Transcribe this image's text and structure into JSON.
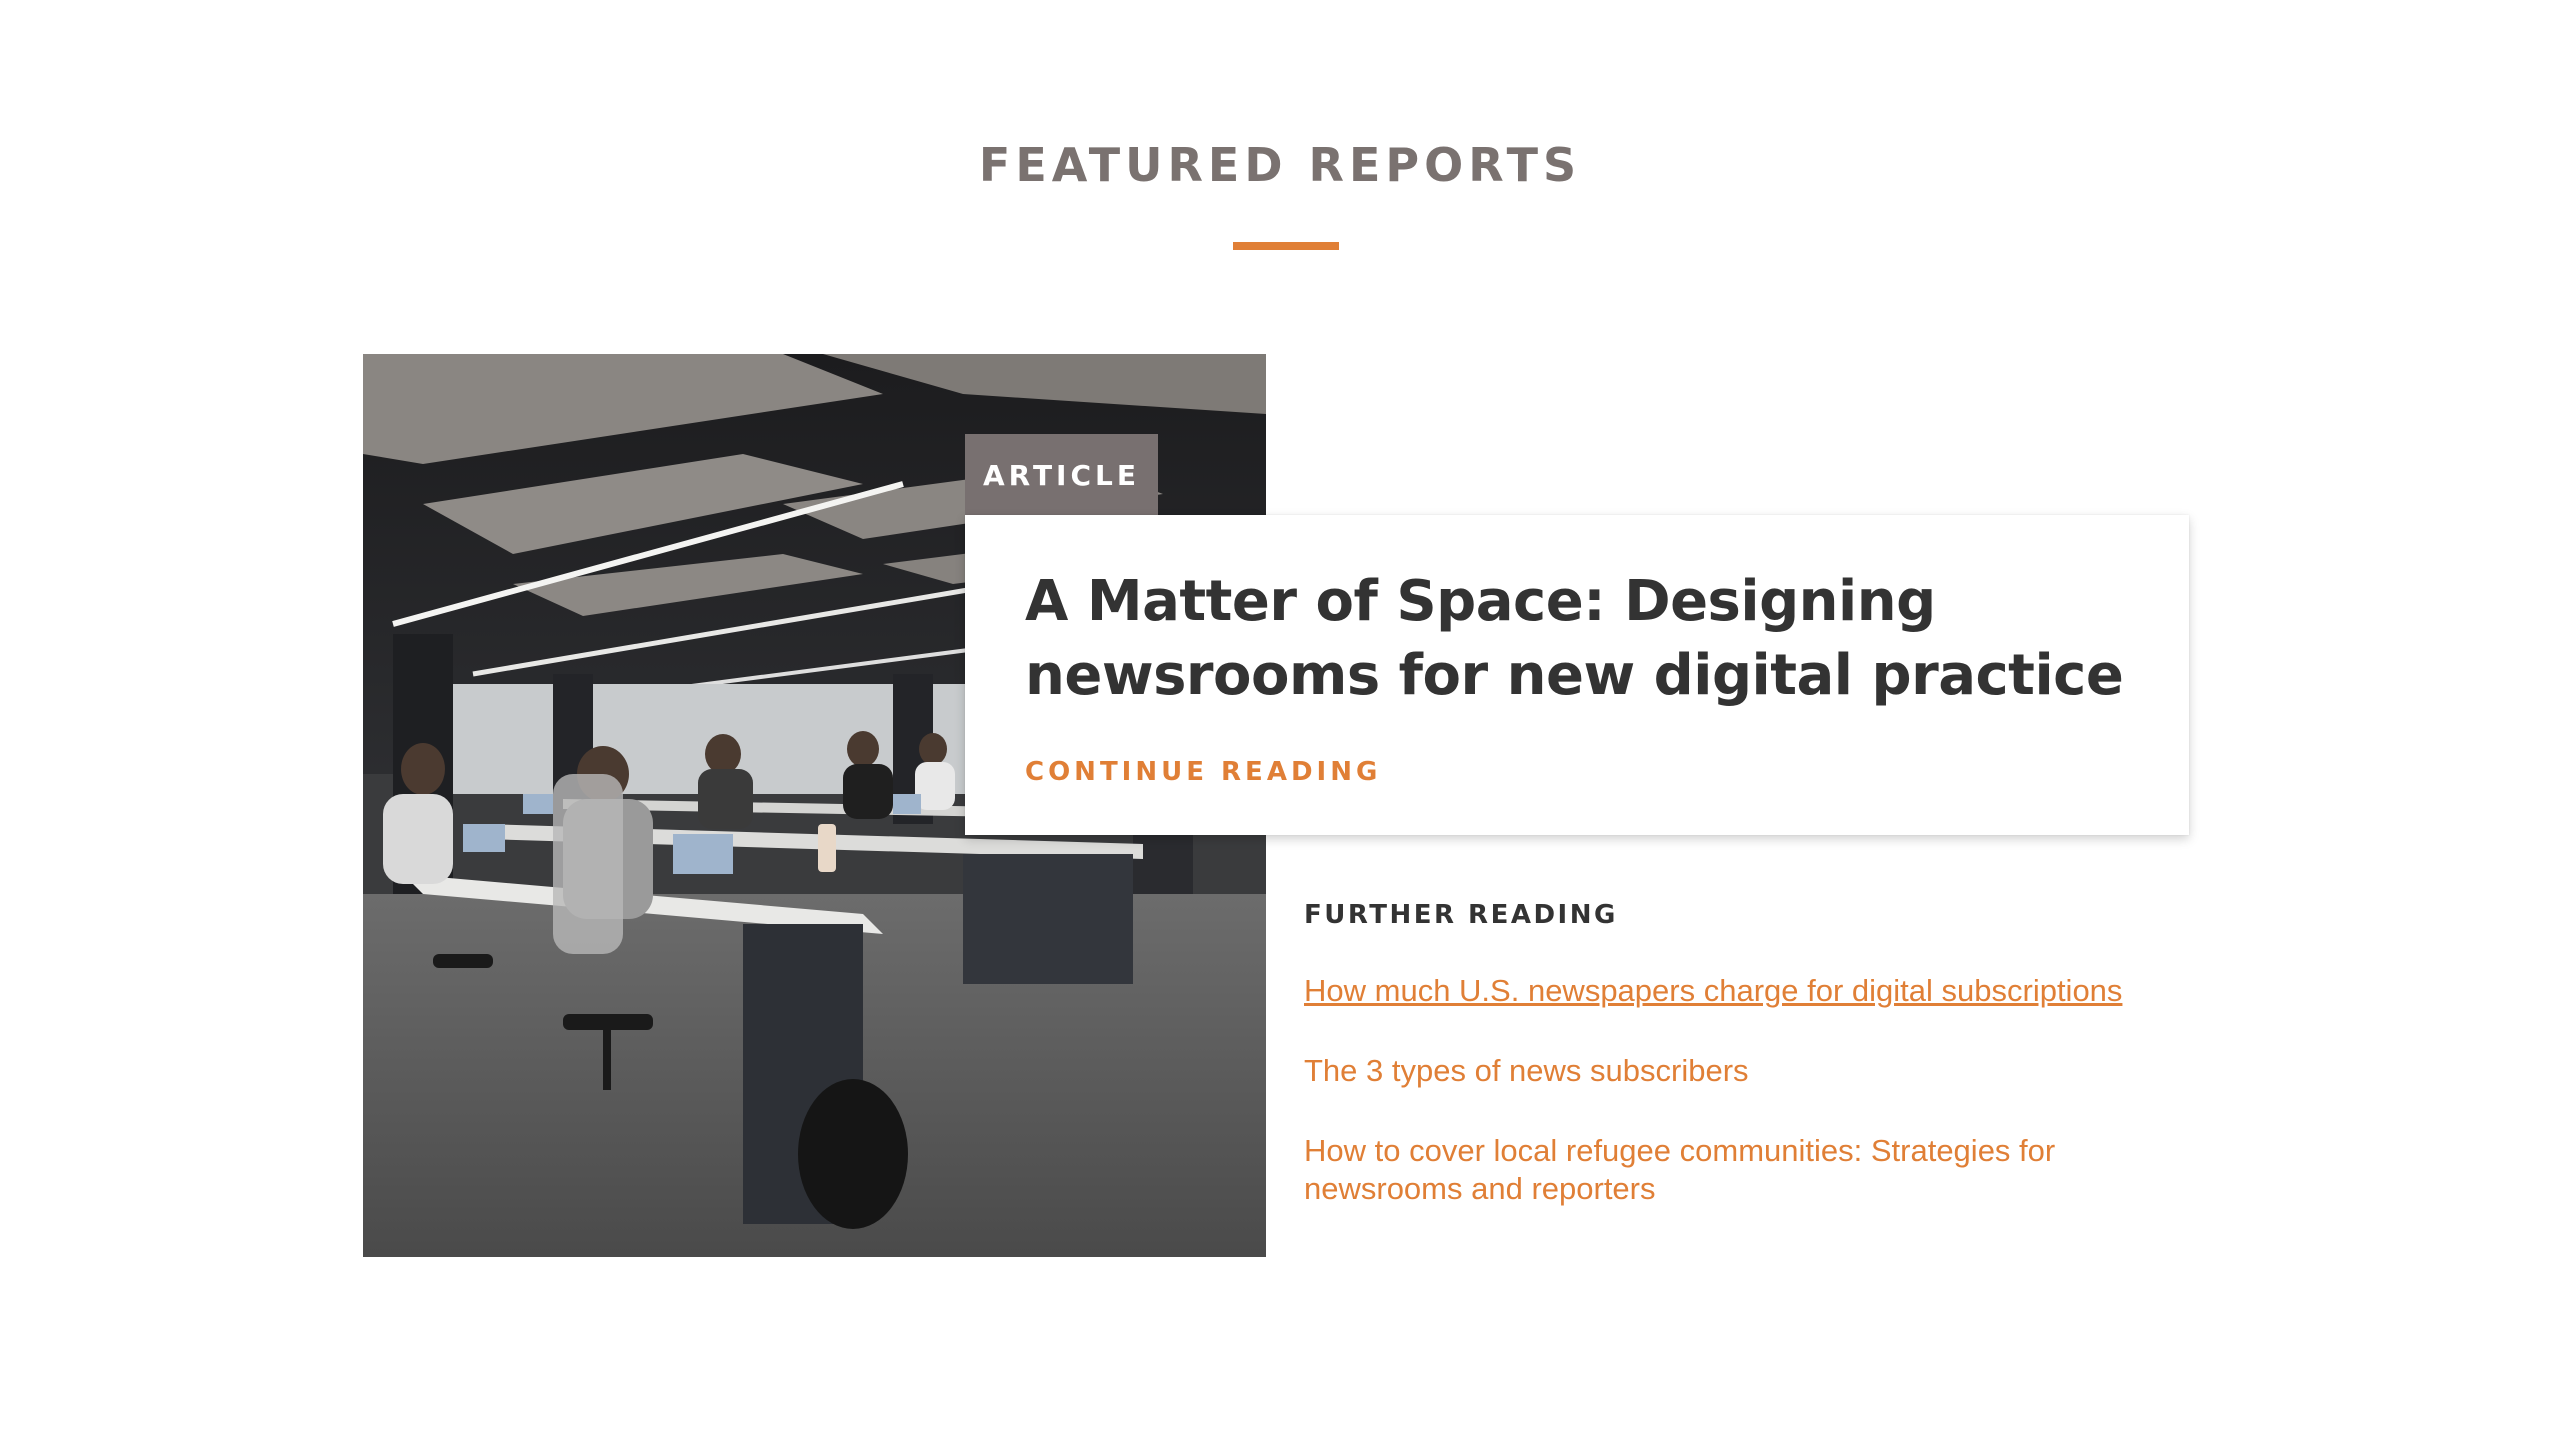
{
  "section": {
    "title": "FEATURED REPORTS",
    "accent_color": "#e07f36"
  },
  "featured": {
    "tag": "ARTICLE",
    "title": "A Matter of Space: Designing newsrooms for new digital practice",
    "cta": "CONTINUE READING",
    "image_alt": "open-plan-office-photo"
  },
  "further_reading": {
    "heading": "FURTHER READING",
    "links": [
      {
        "label": "How much U.S. newspapers charge for digital subscriptions",
        "hovered": true
      },
      {
        "label": "The 3 types of news subscribers",
        "hovered": false
      },
      {
        "label": "How to cover local refugee communities: Strategies for newsrooms and reporters",
        "hovered": false
      }
    ]
  }
}
